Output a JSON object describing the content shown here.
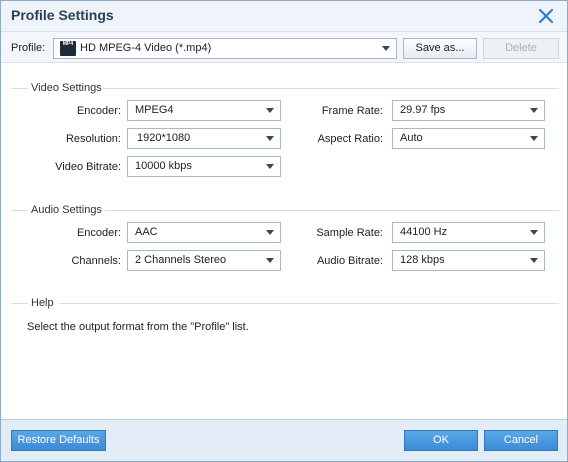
{
  "window": {
    "title": "Profile Settings"
  },
  "profile": {
    "label": "Profile:",
    "icon_text": "MP4",
    "value": "HD MPEG-4 Video (*.mp4)",
    "save_as": "Save as...",
    "delete": "Delete"
  },
  "video": {
    "title": "Video Settings",
    "encoder": {
      "label": "Encoder:",
      "value": "MPEG4"
    },
    "resolution": {
      "label": "Resolution:",
      "value": "1920*1080"
    },
    "bitrate": {
      "label": "Video Bitrate:",
      "value": "10000 kbps"
    },
    "frame_rate": {
      "label": "Frame Rate:",
      "value": "29.97 fps"
    },
    "aspect_ratio": {
      "label": "Aspect Ratio:",
      "value": "Auto"
    }
  },
  "audio": {
    "title": "Audio Settings",
    "encoder": {
      "label": "Encoder:",
      "value": "AAC"
    },
    "channels": {
      "label": "Channels:",
      "value": "2 Channels Stereo"
    },
    "sample_rate": {
      "label": "Sample Rate:",
      "value": "44100 Hz"
    },
    "bitrate": {
      "label": "Audio Bitrate:",
      "value": "128 kbps"
    }
  },
  "help": {
    "title": "Help",
    "text": "Select the output format from the \"Profile\" list."
  },
  "footer": {
    "restore": "Restore Defaults",
    "ok": "OK",
    "cancel": "Cancel"
  }
}
